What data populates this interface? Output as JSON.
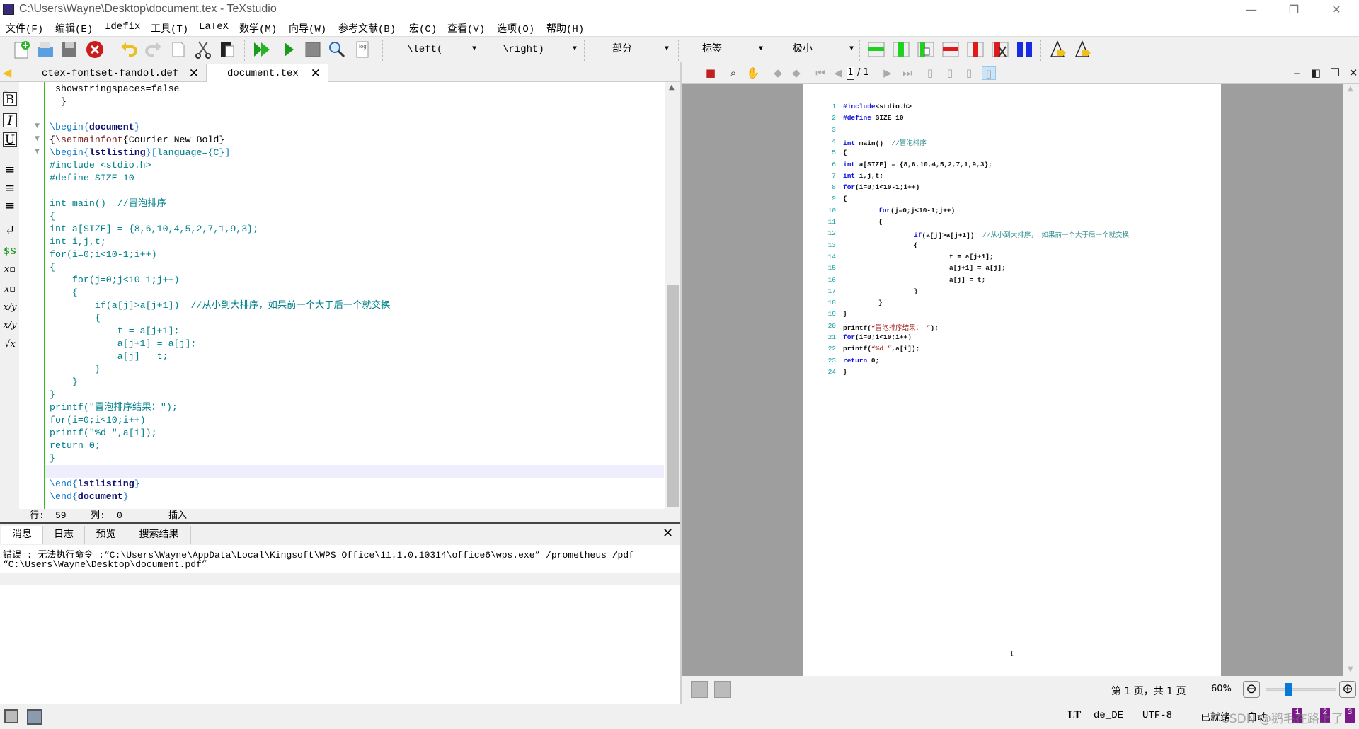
{
  "window": {
    "title": "C:\\Users\\Wayne\\Desktop\\document.tex - TeXstudio",
    "minimize": "—",
    "restore": "❐",
    "close": "✕"
  },
  "menu": [
    "文件(F)",
    "编辑(E)",
    "Idefix",
    "工具(T)",
    "LaTeX",
    "数学(M)",
    "向导(W)",
    "参考文献(B)",
    "宏(C)",
    "查看(V)",
    "选项(O)",
    "帮助(H)"
  ],
  "toolbar": {
    "dropdowns": [
      "\\left(",
      "\\right)",
      "部分",
      "标签",
      "极小"
    ],
    "dropdown_arrow": "▼"
  },
  "tabs": [
    {
      "label": "ctex-fontset-fandol.def",
      "close": "✕"
    },
    {
      "label": "document.tex",
      "close": "✕",
      "active": true
    }
  ],
  "left_tools": [
    {
      "icon": "bold-icon",
      "glyph": "B"
    },
    {
      "icon": "italic-icon",
      "glyph": "I"
    },
    {
      "icon": "underline-icon",
      "glyph": "U"
    },
    {
      "icon": "align-left-icon",
      "glyph": "≡"
    },
    {
      "icon": "align-center-icon",
      "glyph": "≡"
    },
    {
      "icon": "align-right-icon",
      "glyph": "≡"
    },
    {
      "icon": "newline-icon",
      "glyph": "↵"
    },
    {
      "icon": "math-dollar-icon",
      "glyph": "$$"
    },
    {
      "icon": "subscript-icon",
      "glyph": "x▫"
    },
    {
      "icon": "superscript-icon",
      "glyph": "x▫"
    },
    {
      "icon": "fraction-icon",
      "glyph": "x/y"
    },
    {
      "icon": "dfrac-icon",
      "glyph": "x/y"
    },
    {
      "icon": "sqrt-icon",
      "glyph": "√x"
    }
  ],
  "editor": {
    "current_line_index": 30,
    "lines": [
      [
        [
          "n",
          " showstringspaces=false"
        ]
      ],
      [
        [
          "n",
          "  }"
        ]
      ],
      [],
      [
        [
          "k",
          "\\begin{"
        ],
        [
          "b",
          "document"
        ],
        [
          "k",
          "}"
        ]
      ],
      [
        [
          "n",
          "{"
        ],
        [
          "m",
          "\\setmainfont"
        ],
        [
          "n",
          "{Courier New Bold}"
        ]
      ],
      [
        [
          "k",
          "\\begin{"
        ],
        [
          "b",
          "lstlisting"
        ],
        [
          "k",
          "}["
        ],
        [
          "c",
          "language={C}"
        ],
        [
          "k",
          "]"
        ]
      ],
      [
        [
          "c",
          "#include <stdio.h>"
        ]
      ],
      [
        [
          "c",
          "#define SIZE 10"
        ]
      ],
      [],
      [
        [
          "c",
          "int main()  //冒泡排序"
        ]
      ],
      [
        [
          "c",
          "{"
        ]
      ],
      [
        [
          "c",
          "int a[SIZE] = {8,6,10,4,5,2,7,1,9,3};"
        ]
      ],
      [
        [
          "c",
          "int i,j,t;"
        ]
      ],
      [
        [
          "c",
          "for(i=0;i<10-1;i++)"
        ]
      ],
      [
        [
          "c",
          "{"
        ]
      ],
      [
        [
          "c",
          "    for(j=0;j<10-1;j++)"
        ]
      ],
      [
        [
          "c",
          "    {"
        ]
      ],
      [
        [
          "c",
          "        if(a[j]>a[j+1])  //从小到大排序，如果前一个大于后一个就交换"
        ]
      ],
      [
        [
          "c",
          "        {"
        ]
      ],
      [
        [
          "c",
          "            t = a[j+1];"
        ]
      ],
      [
        [
          "c",
          "            a[j+1] = a[j];"
        ]
      ],
      [
        [
          "c",
          "            a[j] = t;"
        ]
      ],
      [
        [
          "c",
          "        }"
        ]
      ],
      [
        [
          "c",
          "    }"
        ]
      ],
      [
        [
          "c",
          "}"
        ]
      ],
      [
        [
          "c",
          "printf(\"冒泡排序结果：\");"
        ]
      ],
      [
        [
          "c",
          "for(i=0;i<10;i++)"
        ]
      ],
      [
        [
          "c",
          "printf(\"%d \",a[i]);"
        ]
      ],
      [
        [
          "c",
          "return 0;"
        ]
      ],
      [
        [
          "c",
          "}"
        ]
      ],
      [],
      [
        [
          "k",
          "\\end{"
        ],
        [
          "b",
          "lstlisting"
        ],
        [
          "k",
          "}"
        ]
      ],
      [
        [
          "k",
          "\\end{"
        ],
        [
          "b",
          "document"
        ],
        [
          "k",
          "}"
        ]
      ]
    ],
    "status": {
      "line_label": "行:",
      "line": "59",
      "col_label": "列:",
      "col": "0",
      "mode": "插入"
    }
  },
  "messages": {
    "tabs": [
      "消息",
      "日志",
      "预览",
      "搜索结果"
    ],
    "close": "✕",
    "lines": [
      "错误 : 无法执行命令 :“C:\\Users\\Wayne\\AppData\\Local\\Kingsoft\\WPS Office\\11.1.0.10314\\office6\\wps.exe” /prometheus /pdf",
      "“C:\\Users\\Wayne\\Desktop\\document.pdf”"
    ]
  },
  "pdf": {
    "page_input": "1",
    "page_total": "/ 1",
    "lines": [
      {
        "n": "1",
        "i": 0,
        "s": [
          [
            "pk",
            "#include"
          ],
          [
            "",
            "<stdio.h>"
          ]
        ]
      },
      {
        "n": "2",
        "i": 0,
        "s": [
          [
            "pk",
            "#define"
          ],
          [
            "",
            " SIZE 10"
          ]
        ]
      },
      {
        "n": "3",
        "i": 0,
        "s": []
      },
      {
        "n": "4",
        "i": 0,
        "s": [
          [
            "pk",
            "int"
          ],
          [
            "",
            " main()  "
          ],
          [
            "pc",
            "//冒泡排序"
          ]
        ]
      },
      {
        "n": "5",
        "i": 0,
        "s": [
          [
            "",
            "{"
          ]
        ]
      },
      {
        "n": "6",
        "i": 0,
        "s": [
          [
            "pk",
            "int"
          ],
          [
            "",
            " a[SIZE] = {8,6,10,4,5,2,7,1,9,3};"
          ]
        ]
      },
      {
        "n": "7",
        "i": 0,
        "s": [
          [
            "pk",
            "int"
          ],
          [
            "",
            " i,j,t;"
          ]
        ]
      },
      {
        "n": "8",
        "i": 0,
        "s": [
          [
            "pk",
            "for"
          ],
          [
            "",
            "(i=0;i<10-1;i++)"
          ]
        ]
      },
      {
        "n": "9",
        "i": 0,
        "s": [
          [
            "",
            "{"
          ]
        ]
      },
      {
        "n": "10",
        "i": 1,
        "s": [
          [
            "pk",
            "for"
          ],
          [
            "",
            "(j=0;j<10-1;j++)"
          ]
        ]
      },
      {
        "n": "11",
        "i": 1,
        "s": [
          [
            "",
            "{"
          ]
        ]
      },
      {
        "n": "12",
        "i": 2,
        "s": [
          [
            "pk",
            "if"
          ],
          [
            "",
            "(a[j]>a[j+1])  "
          ],
          [
            "pc",
            "//从小到大排序， 如果前一个大于后一个就交换"
          ]
        ]
      },
      {
        "n": "13",
        "i": 2,
        "s": [
          [
            "",
            "{"
          ]
        ]
      },
      {
        "n": "14",
        "i": 3,
        "s": [
          [
            "",
            "t = a[j+1];"
          ]
        ]
      },
      {
        "n": "15",
        "i": 3,
        "s": [
          [
            "",
            "a[j+1] = a[j];"
          ]
        ]
      },
      {
        "n": "16",
        "i": 3,
        "s": [
          [
            "",
            "a[j] = t;"
          ]
        ]
      },
      {
        "n": "17",
        "i": 2,
        "s": [
          [
            "",
            "}"
          ]
        ]
      },
      {
        "n": "18",
        "i": 1,
        "s": [
          [
            "",
            "}"
          ]
        ]
      },
      {
        "n": "19",
        "i": 0,
        "s": [
          [
            "",
            "}"
          ]
        ]
      },
      {
        "n": "20",
        "i": 0,
        "s": [
          [
            "",
            "printf("
          ],
          [
            "ps",
            "“冒泡排序结果： ”"
          ],
          [
            "",
            ");"
          ]
        ]
      },
      {
        "n": "21",
        "i": 0,
        "s": [
          [
            "pk",
            "for"
          ],
          [
            "",
            "(i=0;i<10;i++)"
          ]
        ]
      },
      {
        "n": "22",
        "i": 0,
        "s": [
          [
            "",
            "printf("
          ],
          [
            "ps",
            "“%d ”"
          ],
          [
            "",
            ",a[i]);"
          ]
        ]
      },
      {
        "n": "23",
        "i": 0,
        "s": [
          [
            "pk",
            "return"
          ],
          [
            "",
            " 0;"
          ]
        ]
      },
      {
        "n": "24",
        "i": 0,
        "s": [
          [
            "",
            "}"
          ]
        ]
      }
    ],
    "page_number": "1",
    "page_info": "第 1 页，共 1 页",
    "zoom": "60%",
    "zoom_slider_fraction": 0.3
  },
  "statusbar": {
    "lt": "LT",
    "language": "de_DE",
    "encoding": "UTF-8",
    "ready": "已就绪",
    "auto": "自动",
    "bookmarks": [
      "1",
      "2",
      "3"
    ],
    "watermark": "CSDN @鹅毛在路上了"
  },
  "colors": {
    "accent_green": "#3cbc1c",
    "latex_command": "#0a78c8",
    "code_teal": "#00808a",
    "pdf_keyword": "#1414e0"
  }
}
